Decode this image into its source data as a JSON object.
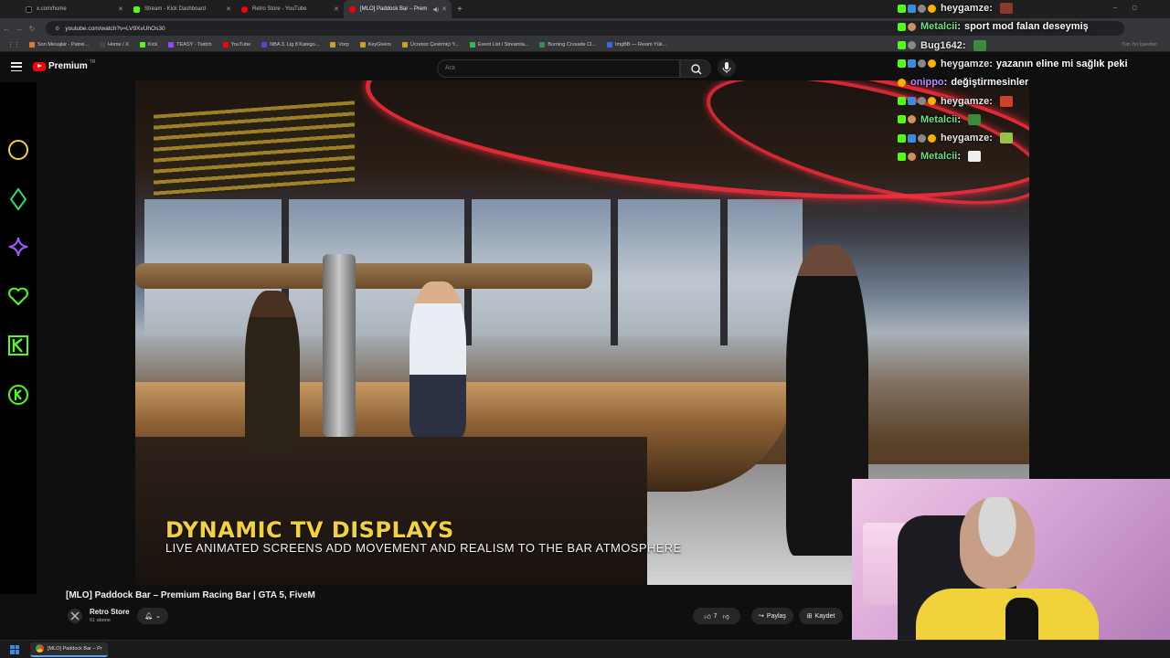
{
  "browser": {
    "tabs": [
      {
        "label": "x.com/home",
        "color": "#1a1a1a"
      },
      {
        "label": "Stream - Kick Dashboard",
        "color": "#53fc18"
      },
      {
        "label": "Retro Store - YouTube",
        "color": "#ff0000"
      },
      {
        "label": "[MLO] Paddock Bar – Prem",
        "color": "#ff0000"
      }
    ],
    "url": "youtube.com/watch?v=LV9XvUhOs30",
    "bookmarks": [
      {
        "label": "Son Mesajlar - Patrei...",
        "color": "#e07a2e"
      },
      {
        "label": "Home / X",
        "color": "#444"
      },
      {
        "label": "Kick",
        "color": "#53fc18"
      },
      {
        "label": "TEASY - Twitch",
        "color": "#9146ff"
      },
      {
        "label": "YouTube",
        "color": "#ff0000"
      },
      {
        "label": "NBA 3. Lig 8 Katego...",
        "color": "#6b3bd8"
      },
      {
        "label": "Vorp",
        "color": "#caa028"
      },
      {
        "label": "KeyGivers",
        "color": "#caa028"
      },
      {
        "label": "Ücretsiz Çevirmiçi Y...",
        "color": "#caa028"
      },
      {
        "label": "Event List / Streamla...",
        "color": "#39b54a"
      },
      {
        "label": "Burning Crusade Cl...",
        "color": "#3a8a4a"
      },
      {
        "label": "ImgBB — Resim Yük...",
        "color": "#3a6ad8"
      }
    ],
    "bookmarks_right": "Tüm Yer İşaretleri"
  },
  "youtube": {
    "logo_text": "Premium",
    "region": "TR",
    "search_placeholder": "Ara",
    "video_title": "[MLO] Paddock Bar – Premium Racing Bar | GTA 5, FiveM",
    "channel_name": "Retro Store",
    "subscribers": "61 abone",
    "likes": "7",
    "share_label": "Paylaş",
    "save_label": "Kaydet"
  },
  "video": {
    "caption_title": "DYNAMIC TV DISPLAYS",
    "caption_subtitle": "LIVE ANIMATED SCREENS ADD MOVEMENT AND REALISM TO THE BAR ATMOSPHERE"
  },
  "chat": [
    {
      "user": "heygamze",
      "msg": "",
      "badges": [
        "k",
        "v",
        "s",
        "g"
      ],
      "ucls": "u-hey",
      "emote": "#8a3a2a"
    },
    {
      "user": "Metalcii",
      "msg": "sport mod falan deseymiş",
      "badges": [
        "k",
        "f"
      ],
      "ucls": "u-metal",
      "emote": ""
    },
    {
      "user": "Bug1642",
      "msg": "",
      "badges": [
        "k",
        "s"
      ],
      "ucls": "u-bug",
      "emote": "#3c8a3c"
    },
    {
      "user": "heygamze",
      "msg": "yazanın eline mi sağlık peki",
      "badges": [
        "k",
        "v",
        "s",
        "g"
      ],
      "ucls": "u-hey",
      "emote": ""
    },
    {
      "user": "onippo",
      "msg": "değiştirmesinler",
      "badges": [
        "g"
      ],
      "ucls": "u-oni",
      "emote": ""
    },
    {
      "user": "heygamze",
      "msg": "",
      "badges": [
        "k",
        "v",
        "s",
        "g"
      ],
      "ucls": "u-hey",
      "emote": "#d0402a"
    },
    {
      "user": "Metalcii",
      "msg": "",
      "badges": [
        "k",
        "f"
      ],
      "ucls": "u-metal",
      "emote": "#3c8a3c"
    },
    {
      "user": "heygamze",
      "msg": "",
      "badges": [
        "k",
        "v",
        "s",
        "g"
      ],
      "ucls": "u-hey",
      "emote": "#9ac24a"
    },
    {
      "user": "Metalcii",
      "msg": "",
      "badges": [
        "k",
        "f"
      ],
      "ucls": "u-metal",
      "emote": "#eeeeee"
    }
  ],
  "taskbar": {
    "chrome_window": "[MLO] Paddock Bar – Pr"
  },
  "colors": {
    "kick_green": "#53fc18",
    "caption_yellow": "#f2d23c",
    "neon_red": "#ff2d3d"
  }
}
